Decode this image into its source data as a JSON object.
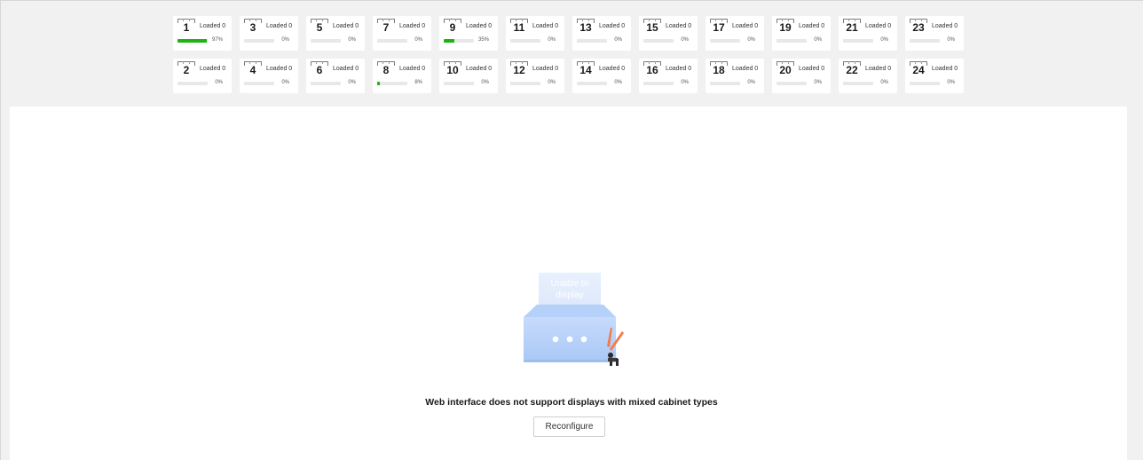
{
  "ports": {
    "row1": [
      {
        "num": "1",
        "loaded": "Loaded 0",
        "pct": "97%",
        "progress": 0.97
      },
      {
        "num": "3",
        "loaded": "Loaded 0",
        "pct": "0%",
        "progress": 0
      },
      {
        "num": "5",
        "loaded": "Loaded 0",
        "pct": "0%",
        "progress": 0
      },
      {
        "num": "7",
        "loaded": "Loaded 0",
        "pct": "0%",
        "progress": 0
      },
      {
        "num": "9",
        "loaded": "Loaded 0",
        "pct": "35%",
        "progress": 0.35
      },
      {
        "num": "11",
        "loaded": "Loaded 0",
        "pct": "0%",
        "progress": 0
      },
      {
        "num": "13",
        "loaded": "Loaded 0",
        "pct": "0%",
        "progress": 0
      },
      {
        "num": "15",
        "loaded": "Loaded 0",
        "pct": "0%",
        "progress": 0
      },
      {
        "num": "17",
        "loaded": "Loaded 0",
        "pct": "0%",
        "progress": 0
      },
      {
        "num": "19",
        "loaded": "Loaded 0",
        "pct": "0%",
        "progress": 0
      },
      {
        "num": "21",
        "loaded": "Loaded 0",
        "pct": "0%",
        "progress": 0
      },
      {
        "num": "23",
        "loaded": "Loaded 0",
        "pct": "0%",
        "progress": 0
      }
    ],
    "row2": [
      {
        "num": "2",
        "loaded": "Loaded 0",
        "pct": "0%",
        "progress": 0
      },
      {
        "num": "4",
        "loaded": "Loaded 0",
        "pct": "0%",
        "progress": 0
      },
      {
        "num": "6",
        "loaded": "Loaded 0",
        "pct": "0%",
        "progress": 0
      },
      {
        "num": "8",
        "loaded": "Loaded 0",
        "pct": "8%",
        "progress": 0.08
      },
      {
        "num": "10",
        "loaded": "Loaded 0",
        "pct": "0%",
        "progress": 0
      },
      {
        "num": "12",
        "loaded": "Loaded 0",
        "pct": "0%",
        "progress": 0
      },
      {
        "num": "14",
        "loaded": "Loaded 0",
        "pct": "0%",
        "progress": 0
      },
      {
        "num": "16",
        "loaded": "Loaded 0",
        "pct": "0%",
        "progress": 0
      },
      {
        "num": "18",
        "loaded": "Loaded 0",
        "pct": "0%",
        "progress": 0
      },
      {
        "num": "20",
        "loaded": "Loaded 0",
        "pct": "0%",
        "progress": 0
      },
      {
        "num": "22",
        "loaded": "Loaded 0",
        "pct": "0%",
        "progress": 0
      },
      {
        "num": "24",
        "loaded": "Loaded 0",
        "pct": "0%",
        "progress": 0
      }
    ]
  },
  "illustration": {
    "icon": "unable-to-display-box-icon",
    "caption": "Unable to display"
  },
  "message": "Web interface does not support displays with mixed cabinet types",
  "reconfigure_label": "Reconfigure",
  "colors": {
    "progress_fill": "#1db311",
    "background": "#f1f1f1"
  }
}
